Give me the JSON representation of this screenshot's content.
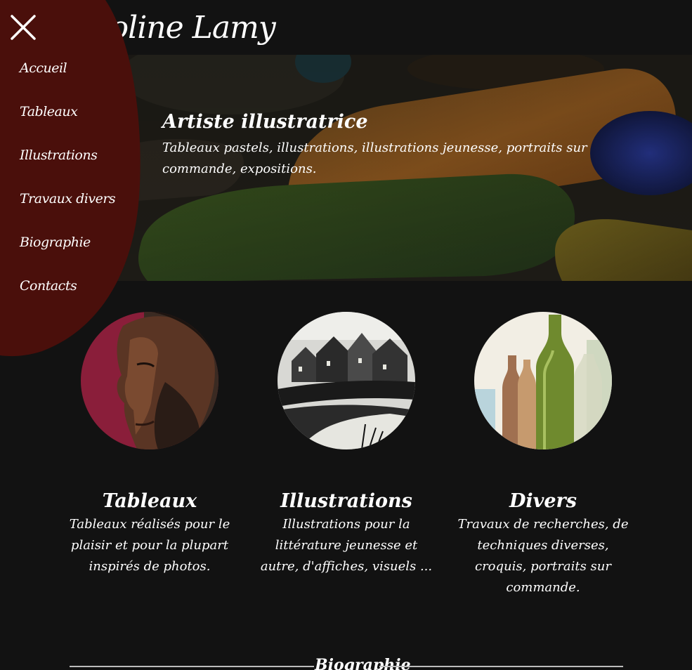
{
  "header": {
    "site_title": "Coline Lamy"
  },
  "menu": {
    "items": [
      {
        "label": "Accueil"
      },
      {
        "label": "Tableaux"
      },
      {
        "label": "Illustrations"
      },
      {
        "label": "Travaux divers"
      },
      {
        "label": "Biographie"
      },
      {
        "label": "Contacts"
      }
    ]
  },
  "hero": {
    "title": "Artiste illustratrice",
    "subtitle": "Tableaux pastels, illustrations, illustrations jeunesse, portraits sur commande, expositions."
  },
  "cards": [
    {
      "title": "Tableaux",
      "text": "Tableaux réalisés pour le plaisir et pour la plupart inspirés de photos."
    },
    {
      "title": "Illustrations",
      "text": "Illustrations pour la littérature jeunesse et autre, d'affiches, visuels ..."
    },
    {
      "title": "Divers",
      "text": "Travaux de recherches, de techniques diverses, croquis, portraits sur commande."
    }
  ],
  "section": {
    "label": "Biographie"
  },
  "colors": {
    "background": "#121212",
    "menu_red": "#4a0f0b",
    "divider": "#bdbdbd"
  }
}
